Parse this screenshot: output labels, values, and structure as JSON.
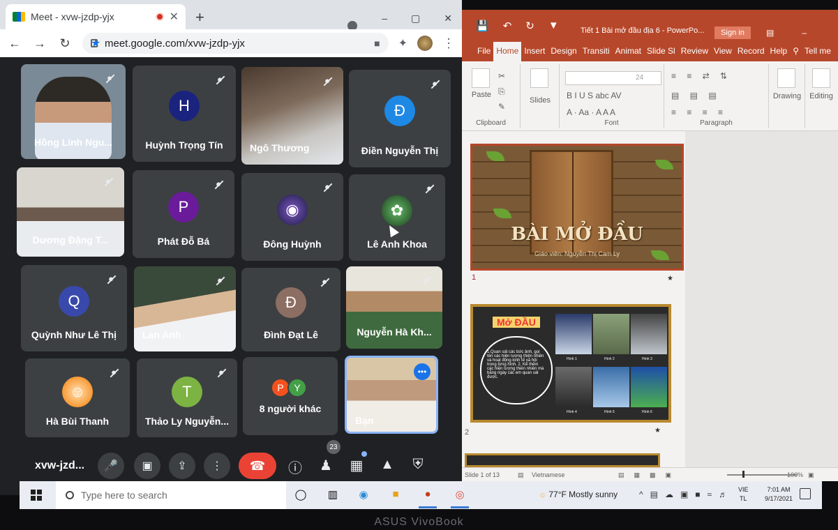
{
  "browser": {
    "tab_title": "Meet - xvw-jzdp-yjx",
    "url": "meet.google.com/xvw-jzdp-yjx",
    "new_tab_glyph": "+",
    "close_glyph": "✕",
    "window_controls": [
      "–",
      "▢",
      "✕"
    ],
    "nav_icons": [
      "back-icon",
      "forward-icon",
      "reload-icon"
    ]
  },
  "meet": {
    "participants": [
      {
        "name": "Hồng Linh Ngu...",
        "kind": "video"
      },
      {
        "name": "Huỳnh Trọng Tín",
        "kind": "avatar",
        "initial": "H",
        "color": "#1a237e"
      },
      {
        "name": "Ngô Thương",
        "kind": "video"
      },
      {
        "name": "Điền Nguyễn Thị",
        "kind": "avatar",
        "initial": "Đ",
        "color": "#1e88e5"
      },
      {
        "name": "Dương Đặng T...",
        "kind": "video"
      },
      {
        "name": "Phát Đỗ Bá",
        "kind": "avatar",
        "initial": "P",
        "color": "#6a1b9a"
      },
      {
        "name": "Đông Huỳnh",
        "kind": "avatar-image"
      },
      {
        "name": "Lê Anh Khoa",
        "kind": "avatar-image"
      },
      {
        "name": "Quỳnh Như Lê Thị",
        "kind": "avatar",
        "initial": "Q",
        "color": "#3949ab"
      },
      {
        "name": "Lan Anh",
        "kind": "video"
      },
      {
        "name": "Đình Đạt Lê",
        "kind": "avatar",
        "initial": "Đ",
        "color": "#8d6e63"
      },
      {
        "name": "Nguyễn Hà Kh...",
        "kind": "video"
      },
      {
        "name": "Hà Bùi Thanh",
        "kind": "avatar-image"
      },
      {
        "name": "Thảo Ly Nguyễn...",
        "kind": "avatar",
        "initial": "T",
        "color": "#7cb342"
      },
      {
        "name": "8 người khác",
        "kind": "others",
        "initials": [
          "P",
          "Y"
        ]
      },
      {
        "name": "Bạn",
        "kind": "self"
      }
    ],
    "meeting_code": "xvw-jzd...",
    "people_count": "23",
    "more_glyph": "•••"
  },
  "ppt": {
    "doc_title": "Tiết 1  Bài mở đầu địa 6  -  PowerPo...",
    "sign_in": "Sign in",
    "tabs": [
      "File",
      "Home",
      "Insert",
      "Design",
      "Transiti",
      "Animat",
      "Slide Sl",
      "Review",
      "View",
      "Record",
      "Help",
      "Tell me"
    ],
    "active_tab": "Home",
    "ribbon": {
      "paste": "Paste",
      "clipboard": "Clipboard",
      "slides": "Slides",
      "font": "Font",
      "font_size": "24",
      "font_buttons": "B  I  U  S  abc  AV",
      "font_buttons2": "A  ·  Aa ·  A  A  A",
      "paragraph": "Paragraph",
      "drawing": "Drawing",
      "editing": "Editing"
    },
    "slide1": {
      "title": "BÀI MỞ ĐẦU",
      "subtitle": "Giáo viên: Nguyễn Thị Cam Ly",
      "num": "1"
    },
    "slide2": {
      "heading": "Mở ĐẦU",
      "bubble_text": "1.Quan sát các bức ảnh, gọi tên các hiện tượng thiên nhiên và hoạt động kinh tế xã hội trong từng hình.\n2. Kể thêm các hiện tượng thiên nhiên mà bằng ngày các em quan sát được.",
      "captions": [
        "Hình 1",
        "Hình 2",
        "Hình 3",
        "Hình 4",
        "Hình 5",
        "Hình 6"
      ],
      "num": "2"
    },
    "status": {
      "slide": "Slide 1 of 13",
      "language": "Vietnamese",
      "zoom": "100%"
    }
  },
  "taskbar": {
    "search_placeholder": "Type here to search",
    "weather": "77°F  Mostly sunny",
    "lang_top": "VIE",
    "lang_bottom": "TL",
    "time": "7:01 AM",
    "date": "9/17/2021"
  },
  "bezel": {
    "brand": "ASUS VivoBook"
  }
}
